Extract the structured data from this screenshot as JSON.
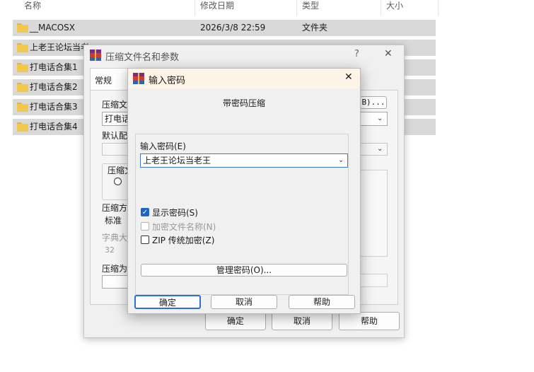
{
  "explorer": {
    "columns": {
      "name": "名称",
      "date": "修改日期",
      "type": "类型",
      "size": "大小"
    },
    "rows": [
      {
        "name": "__MACOSX",
        "date": "2026/3/8 22:59",
        "type": "文件夹"
      },
      {
        "name": "上老王论坛当老"
      },
      {
        "name": "打电话合集1"
      },
      {
        "name": "打电话合集2"
      },
      {
        "name": "打电话合集3"
      },
      {
        "name": "打电话合集4"
      }
    ]
  },
  "archive_dialog": {
    "title": "压缩文件名和参数",
    "help": "?",
    "close": "✕",
    "tab_general": "常规",
    "label_archive_name": "压缩文",
    "archive_name_value": "打电话",
    "browse_fragment": "B)...",
    "label_default_profile": "默认配",
    "label_format": "压缩文",
    "label_method": "压缩方",
    "method_value": "标准",
    "label_dict": "字典大",
    "dict_value": "32",
    "label_split": "压缩为",
    "ok": "确定",
    "cancel": "取消",
    "help_btn": "帮助"
  },
  "password_dialog": {
    "title": "输入密码",
    "close": "✕",
    "heading": "带密码压缩",
    "label_password": "输入密码(E)",
    "password_value": "上老王论坛当老王",
    "show_password": "显示密码(S)",
    "show_password_checked": true,
    "encrypt_names": "加密文件名称(N)",
    "zip_legacy": "ZIP 传统加密(Z)",
    "manage_passwords": "管理密码(O)...",
    "ok": "确定",
    "cancel": "取消",
    "help": "帮助"
  },
  "colors": {
    "selection": "#d9d9d9",
    "checkbox_accent": "#1f63c6",
    "folder": "#f2c94c"
  }
}
